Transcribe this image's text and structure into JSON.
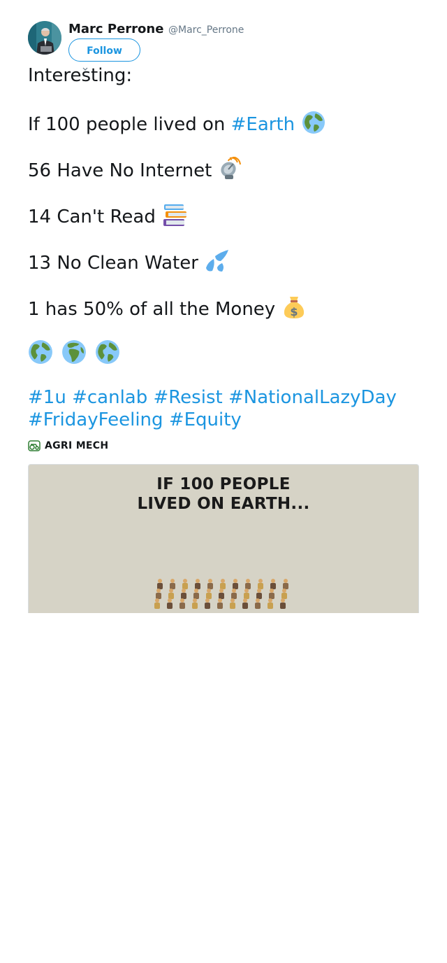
{
  "author": {
    "name": "Marc Perrone",
    "handle": "@Marc_Perrone",
    "follow_label": "Follow"
  },
  "tweet": {
    "line_intro": "Interesting:",
    "line1_text": "If 100 people lived on ",
    "line1_tag": "#Earth",
    "line1_emoji": "globe-americas-icon",
    "line2_text": "56 Have No Internet",
    "line2_emoji": "satellite-antenna-icon",
    "line3_text": "14 Can't Read",
    "line3_emoji": "books-icon",
    "line4_text": "13 No Clean Water",
    "line4_emoji": "sweat-droplets-icon",
    "line5_text": "1 has 50% of all the Money",
    "line5_emoji": "money-bag-icon",
    "globes": [
      "globe-americas-icon",
      "globe-europe-africa-icon",
      "globe-americas-icon"
    ],
    "hashtags_line1": [
      "#1u",
      "#canlab",
      "#Resist",
      "#NationalLazyDay"
    ],
    "hashtags_line2": [
      "#FridayFeeling",
      "#Equity"
    ]
  },
  "source": {
    "label": "AGRI MECH",
    "icon": "agri-mech-logo"
  },
  "media": {
    "title_line1": "IF 100 PEOPLE",
    "title_line2": "LIVED ON EARTH..."
  },
  "colors": {
    "link": "#1b95e0",
    "text": "#14171a",
    "muted": "#657786",
    "media_bg": "#d6d3c6"
  }
}
